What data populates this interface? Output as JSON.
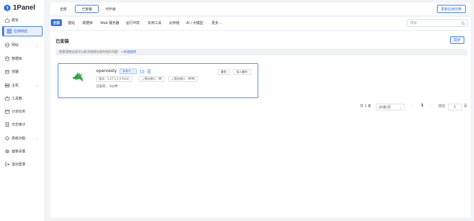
{
  "app": {
    "name": "1Panel",
    "brand_color": "#2f6fe8"
  },
  "sidebar": {
    "items": [
      {
        "label": "概览",
        "icon": "home-icon"
      },
      {
        "label": "应用商店",
        "icon": "grid-icon",
        "active": true
      },
      {
        "label": "网站",
        "icon": "globe-icon",
        "expand": true
      },
      {
        "label": "数据库",
        "icon": "database-icon"
      },
      {
        "label": "容器",
        "icon": "box-icon"
      },
      {
        "label": "主机",
        "icon": "server-icon",
        "expand": true
      },
      {
        "label": "工具箱",
        "icon": "toolbox-icon"
      },
      {
        "label": "计划任务",
        "icon": "calendar-icon"
      },
      {
        "label": "日志审计",
        "icon": "log-icon"
      },
      {
        "label": "高级功能",
        "icon": "diamond-icon",
        "expand": true
      },
      {
        "label": "面板设置",
        "icon": "settings-icon"
      },
      {
        "label": "退出登录",
        "icon": "logout-icon"
      }
    ]
  },
  "topbar": {
    "tabs": [
      "全部",
      "已安装",
      "可升级"
    ],
    "active_tab": 1,
    "update_button": "更新应用列表"
  },
  "filters": {
    "items": [
      "全部",
      "建站",
      "数据库",
      "Web 服务器",
      "运行环境",
      "实用工具",
      "云存储",
      "AI / 大模型",
      "更多"
    ],
    "active": 0
  },
  "search": {
    "placeholder": "搜索"
  },
  "installed": {
    "title": "已安装",
    "sync_button": "同步",
    "notice": "配置镜像加速可以解决镜像拉取失败的问题",
    "notice_link": "快速跳转"
  },
  "card": {
    "name": "openresty",
    "status": "安装中",
    "backup_button": "备份",
    "import_backup_button": "导入备份",
    "version": "版本：1.27.1.2-2-focal",
    "http_port": "服务端口：86",
    "https_port": "服务端口：8990",
    "installed_time": "已安装：  9分钟"
  },
  "pagination": {
    "total": "共 1 条",
    "page_size": "20条/页",
    "current_page": "1",
    "goto_label": "前往",
    "goto_value": "1",
    "page_suffix": "页"
  }
}
